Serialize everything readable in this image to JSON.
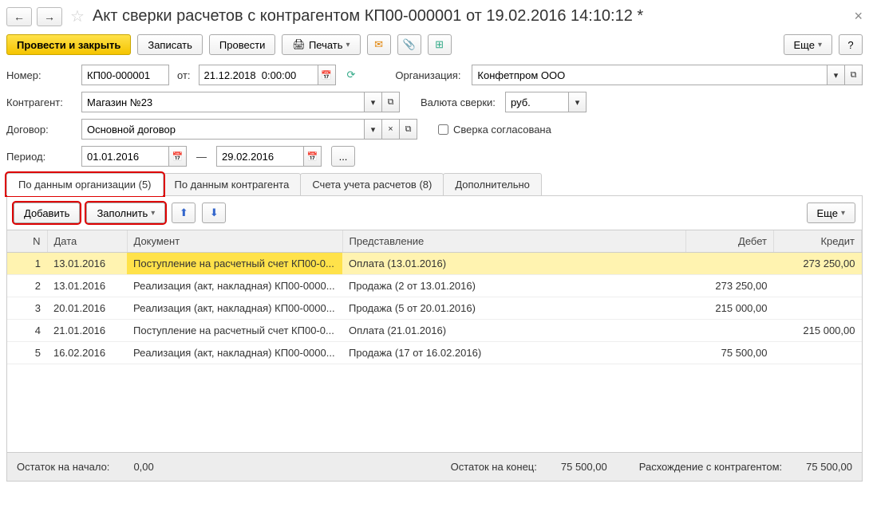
{
  "title": "Акт сверки расчетов с контрагентом КП00-000001 от 19.02.2016 14:10:12 *",
  "toolbar": {
    "save_close": "Провести и закрыть",
    "write": "Записать",
    "post": "Провести",
    "print": "Печать",
    "more": "Еще",
    "help": "?"
  },
  "form": {
    "number_label": "Номер:",
    "number": "КП00-000001",
    "from_label": "от:",
    "date": "21.12.2018  0:00:00",
    "org_label": "Организация:",
    "org": "Конфетпром ООО",
    "partner_label": "Контрагент:",
    "partner": "Магазин №23",
    "currency_label": "Валюта сверки:",
    "currency": "руб.",
    "contract_label": "Договор:",
    "contract": "Основной договор",
    "agreed_label": "Сверка согласована",
    "period_label": "Период:",
    "period_from": "01.01.2016",
    "period_to": "29.02.2016",
    "dash": "—",
    "ellipsis": "..."
  },
  "tabs": [
    {
      "label": "По данным организации (5)",
      "active": true,
      "highlight": true
    },
    {
      "label": "По данным контрагента",
      "active": false
    },
    {
      "label": "Счета учета расчетов (8)",
      "active": false
    },
    {
      "label": "Дополнительно",
      "active": false
    }
  ],
  "subtoolbar": {
    "add": "Добавить",
    "fill": "Заполнить",
    "more": "Еще"
  },
  "columns": {
    "n": "N",
    "date": "Дата",
    "doc": "Документ",
    "repr": "Представление",
    "debit": "Дебет",
    "credit": "Кредит"
  },
  "rows": [
    {
      "n": "1",
      "date": "13.01.2016",
      "doc": "Поступление на расчетный счет КП00-0...",
      "repr": "Оплата (13.01.2016)",
      "debit": "",
      "credit": "273 250,00",
      "selected": true
    },
    {
      "n": "2",
      "date": "13.01.2016",
      "doc": "Реализация (акт, накладная) КП00-0000...",
      "repr": "Продажа (2 от 13.01.2016)",
      "debit": "273 250,00",
      "credit": ""
    },
    {
      "n": "3",
      "date": "20.01.2016",
      "doc": "Реализация (акт, накладная) КП00-0000...",
      "repr": "Продажа (5 от 20.01.2016)",
      "debit": "215 000,00",
      "credit": ""
    },
    {
      "n": "4",
      "date": "21.01.2016",
      "doc": "Поступление на расчетный счет КП00-0...",
      "repr": "Оплата (21.01.2016)",
      "debit": "",
      "credit": "215 000,00"
    },
    {
      "n": "5",
      "date": "16.02.2016",
      "doc": "Реализация (акт, накладная) КП00-0000...",
      "repr": "Продажа (17 от 16.02.2016)",
      "debit": "75 500,00",
      "credit": ""
    }
  ],
  "footer": {
    "start_label": "Остаток на начало:",
    "start": "0,00",
    "end_label": "Остаток на конец:",
    "end": "75 500,00",
    "diff_label": "Расхождение с контрагентом:",
    "diff": "75 500,00"
  }
}
